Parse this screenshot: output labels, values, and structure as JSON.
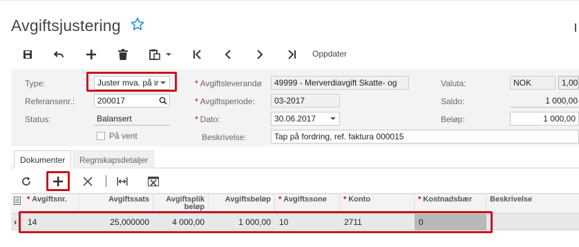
{
  "header": {
    "title": "Avgiftsjustering"
  },
  "toolbar": {
    "update_label": "Oppdater"
  },
  "form": {
    "type": {
      "label": "Type:",
      "value": "Juster mva. på ir"
    },
    "ref": {
      "label": "Referansenr.:",
      "value": "200017"
    },
    "status": {
      "label": "Status:",
      "value": "Balansert"
    },
    "on_hold": {
      "label": "På vent",
      "checked": false
    },
    "supplier": {
      "label": "Avgiftsleverandø",
      "value": "49999 - Merverdiavgift Skatte- og"
    },
    "period": {
      "label": "Avgiftsperiode:",
      "value": "03-2017"
    },
    "date": {
      "label": "Dato:",
      "value": "30.06.2017"
    },
    "description": {
      "label": "Beskrivelse:",
      "value": "Tap på fordring, ref. faktura 000015"
    },
    "currency": {
      "label": "Valuta:",
      "value": "NOK",
      "rate": "1,00"
    },
    "balance": {
      "label": "Saldo:",
      "value": "1 000,00"
    },
    "amount": {
      "label": "Beløp:",
      "value": "1 000,00"
    }
  },
  "tabs": [
    {
      "label": "Dokumenter",
      "active": true
    },
    {
      "label": "Regnskapsdetaljer",
      "active": false
    }
  ],
  "grid": {
    "columns": {
      "taxnr": "Avgiftsnr.",
      "rate": "Avgiftssats",
      "taxable": "Avgiftsplik beløp",
      "taxamount": "Avgiftsbeløp",
      "zone": "Avgiftssone",
      "account": "Konto",
      "costcenter": "Kostnadsbær",
      "desc": "Beskrivelse"
    },
    "row": {
      "indicator": "›",
      "taxnr": "14",
      "rate": "25,000000",
      "taxable": "4 000,00",
      "taxamount": "1 000,00",
      "zone": "10",
      "account": "2711",
      "costcenter": "0",
      "desc": ""
    }
  },
  "colors": {
    "highlight": "#c8141e",
    "required": "#cc0000",
    "star": "#2a8fd6"
  }
}
